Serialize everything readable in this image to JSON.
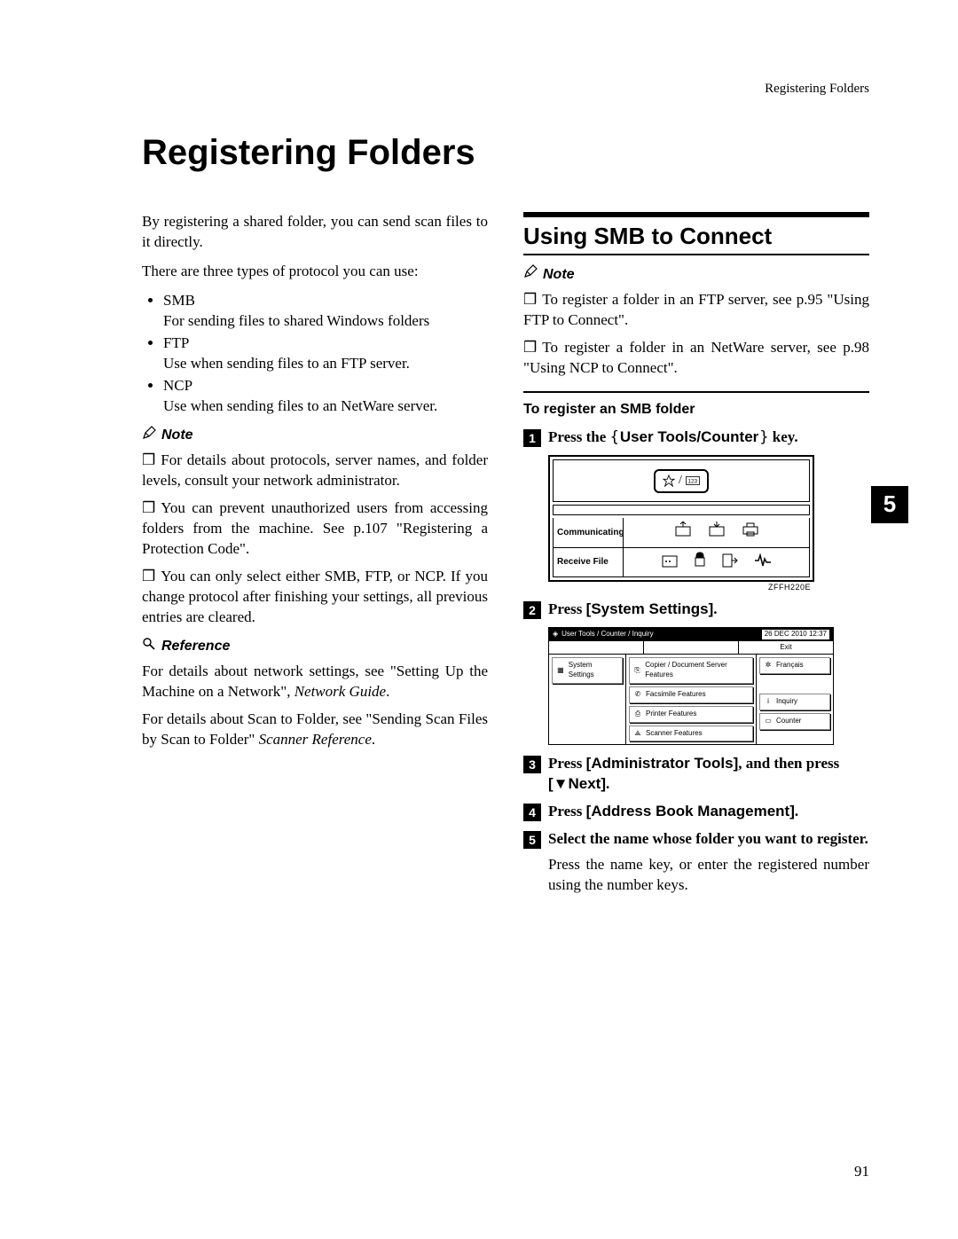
{
  "header": {
    "running": "Registering Folders"
  },
  "title": "Registering Folders",
  "left": {
    "intro1": "By registering a shared folder, you can send scan files to it directly.",
    "intro2": "There are three types of protocol you can use:",
    "protocols": {
      "smb_name": "SMB",
      "smb_desc": "For sending files to shared Windows folders",
      "ftp_name": "FTP",
      "ftp_desc": "Use when sending files to an FTP server.",
      "ncp_name": "NCP",
      "ncp_desc": "Use when sending files to an NetWare server."
    },
    "note_label": "Note",
    "notes": [
      "For details about protocols, server names, and folder levels, consult your network administrator.",
      "You can prevent unauthorized users from accessing folders from the machine. See p.107 \"Registering a Protection Code\".",
      "You can only select either SMB, FTP, or NCP. If you change protocol after finishing your settings, all previous entries are cleared."
    ],
    "reference_label": "Reference",
    "ref1a": "For details about network settings, see \"Setting Up the Machine on a Network\", ",
    "ref1b": "Network Guide",
    "ref1c": ".",
    "ref2a": "For details about Scan to Folder, see \"Sending Scan Files by Scan to Folder\" ",
    "ref2b": "Scanner Reference",
    "ref2c": "."
  },
  "right": {
    "section": "Using SMB to Connect",
    "note_label": "Note",
    "notes": [
      "To register a folder in an FTP server, see p.95 \"Using FTP to Connect\".",
      "To register a folder in an NetWare server, see p.98 \"Using NCP to Connect\"."
    ],
    "subsection": "To register an SMB folder",
    "step1_a": "Press the ",
    "step1_key": "User Tools/Counter",
    "step1_b": " key.",
    "fig1": {
      "row1_label": "Communicating",
      "row2_label": "Receive File",
      "caption": "ZFFH220E"
    },
    "step2_a": "Press ",
    "step2_key": "[System Settings]",
    "step2_b": ".",
    "fig2": {
      "title": "User Tools / Counter / Inquiry",
      "timestamp": "26 DEC 2010 12:37",
      "exit": "Exit",
      "left_btn": "System Settings",
      "mid1": "Copier / Document Server Features",
      "mid2": "Facsimile Features",
      "mid3": "Printer Features",
      "mid4": "Scanner Features",
      "right1": "Français",
      "right2": "Inquiry",
      "right3": "Counter"
    },
    "step3_a": "Press ",
    "step3_key1": "[Administrator Tools]",
    "step3_b": ", and then press ",
    "step3_key2": "[▼Next]",
    "step3_c": ".",
    "step4_a": "Press ",
    "step4_key": "[Address Book Management]",
    "step4_b": ".",
    "step5": "Select the name whose folder you want to register.",
    "step5_body": "Press the name key, or enter the registered number using the number keys."
  },
  "tab": "5",
  "page": "91"
}
